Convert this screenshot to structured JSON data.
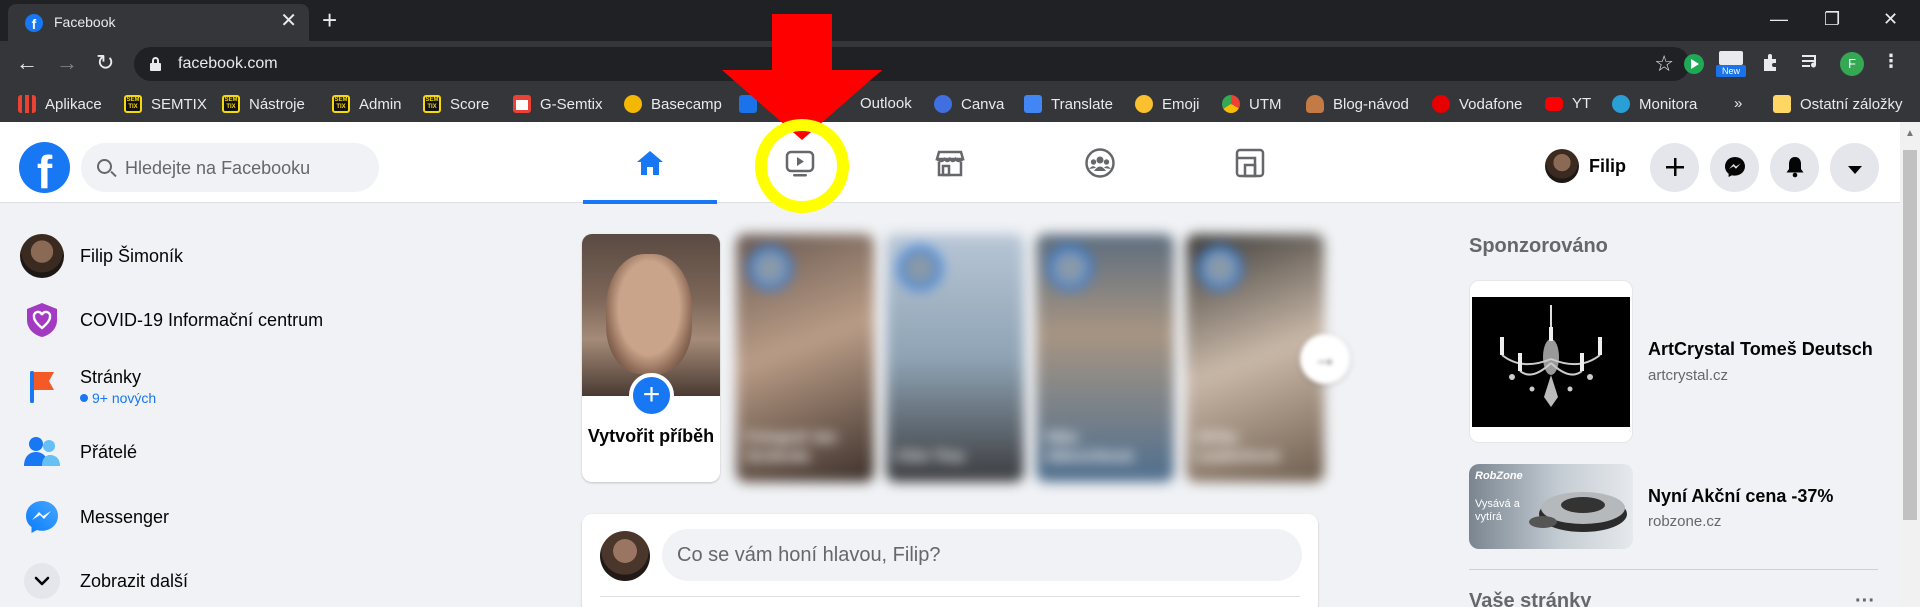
{
  "browser": {
    "tab_title": "Facebook",
    "url": "facebook.com",
    "bookmarks": [
      {
        "label": "Aplikace",
        "icon": "apps-grid-icon"
      },
      {
        "label": "SEMTIX",
        "icon": "semtix-icon"
      },
      {
        "label": "Nástroje",
        "icon": "semtix-icon"
      },
      {
        "label": "Admin",
        "icon": "semtix-icon"
      },
      {
        "label": "Score",
        "icon": "semtix-icon"
      },
      {
        "label": "G-Semtix",
        "icon": "gmail-icon"
      },
      {
        "label": "Basecamp",
        "icon": "basecamp-icon"
      },
      {
        "label": "Outlook",
        "icon": "outlook-icon"
      },
      {
        "label": "Canva",
        "icon": "canva-icon"
      },
      {
        "label": "Translate",
        "icon": "translate-icon"
      },
      {
        "label": "Emoji",
        "icon": "emoji-icon"
      },
      {
        "label": "UTM",
        "icon": "utm-icon"
      },
      {
        "label": "Blog-návod",
        "icon": "blog-icon"
      },
      {
        "label": "Vodafone",
        "icon": "vodafone-icon"
      },
      {
        "label": "YT",
        "icon": "youtube-icon"
      },
      {
        "label": "Monitora",
        "icon": "monitora-icon"
      }
    ],
    "overflow_label": "»",
    "other_bookmarks": "Ostatní záložky",
    "extension_badge": "New",
    "profile_initial": "F"
  },
  "fb": {
    "search_placeholder": "Hledejte na Facebooku",
    "profile_name": "Filip",
    "left_menu": [
      {
        "label": "Filip Šimoník"
      },
      {
        "label": "COVID-19 Informační centrum"
      },
      {
        "label": "Stránky",
        "sub": "9+ nových"
      },
      {
        "label": "Přátelé"
      },
      {
        "label": "Messenger"
      },
      {
        "label": "Zobrazit další"
      }
    ],
    "create_story": "Vytvořit příběh",
    "stories": [
      {
        "name": "Fotograf Jan Svoboda"
      },
      {
        "name": "Chin Tina"
      },
      {
        "name": "Nika Albrechtová"
      },
      {
        "name": "Ulrika Laubichová"
      }
    ],
    "composer_placeholder": "Co se vám honí hlavou, Filip?",
    "sponsored_heading": "Sponzorováno",
    "ads": [
      {
        "title": "ArtCrystal Tomeš Deutsch",
        "domain": "artcrystal.cz"
      },
      {
        "title": "Nyní Akční cena -37%",
        "domain": "robzone.cz",
        "img_brand": "RobZone",
        "img_caption": "Vysává a vytírá"
      }
    ],
    "your_pages_heading": "Vaše stránky",
    "more_dots": "···"
  },
  "colors": {
    "fb_blue": "#1877f2",
    "annotation_arrow": "#ff0000",
    "annotation_circle": "#ffff00"
  }
}
